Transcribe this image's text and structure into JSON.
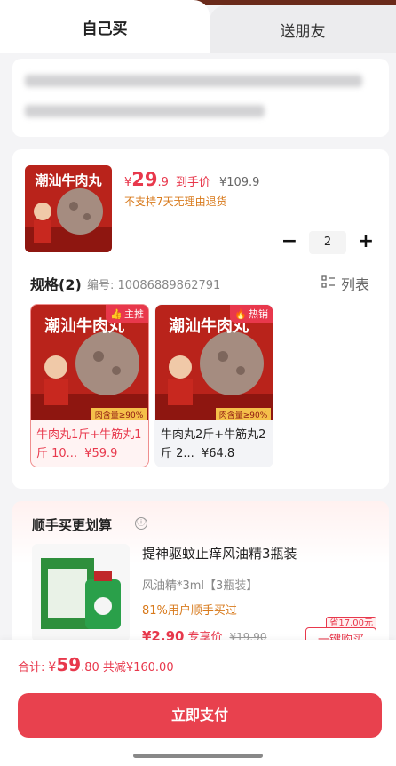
{
  "tabs": {
    "self": "自己买",
    "gift": "送朋友"
  },
  "product": {
    "thumb_title": "潮汕牛肉丸",
    "price_currency": "¥",
    "price_int": "29",
    "price_dec": ".9",
    "price_label": "到手价",
    "original_price": "¥109.9",
    "return_note": "不支持7天无理由退货",
    "quantity": "2",
    "minus": "−",
    "plus": "+"
  },
  "spec": {
    "title": "规格(2)",
    "code": "编号: 10086889862791",
    "list_label": "列表",
    "variants": [
      {
        "title": "潮汕牛肉丸",
        "badge": "主推",
        "label": "牛肉丸1斤+牛筋丸1斤 10...",
        "price": "¥59.9",
        "content": "肉含量≥90%",
        "selected": true
      },
      {
        "title": "潮汕牛肉丸",
        "badge": "热销",
        "label": "牛肉丸2斤+牛筋丸2斤 2...",
        "price": "¥64.8",
        "content": "肉含量≥90%",
        "selected": false
      }
    ]
  },
  "addon": {
    "title": "顺手买更划算",
    "info_icon": "ⓘ",
    "name": "提神驱蚊止痒风油精3瓶装",
    "spec": "风油精*3ml【3瓶装】",
    "stat": "81%用户顺手买过",
    "price": "¥2.90",
    "price_label": "专享价",
    "orig_price": "¥19.90",
    "save_tag": "省17.00元",
    "button": "一键购买"
  },
  "footer": {
    "total_label": "合计:",
    "currency": "¥",
    "total_int": "59",
    "total_dec": ".80",
    "discount": "共减¥160.00",
    "pay_button": "立即支付"
  },
  "colors": {
    "accent": "#e8384c",
    "warning": "#d87a1c",
    "bg": "#f4f4f6"
  }
}
